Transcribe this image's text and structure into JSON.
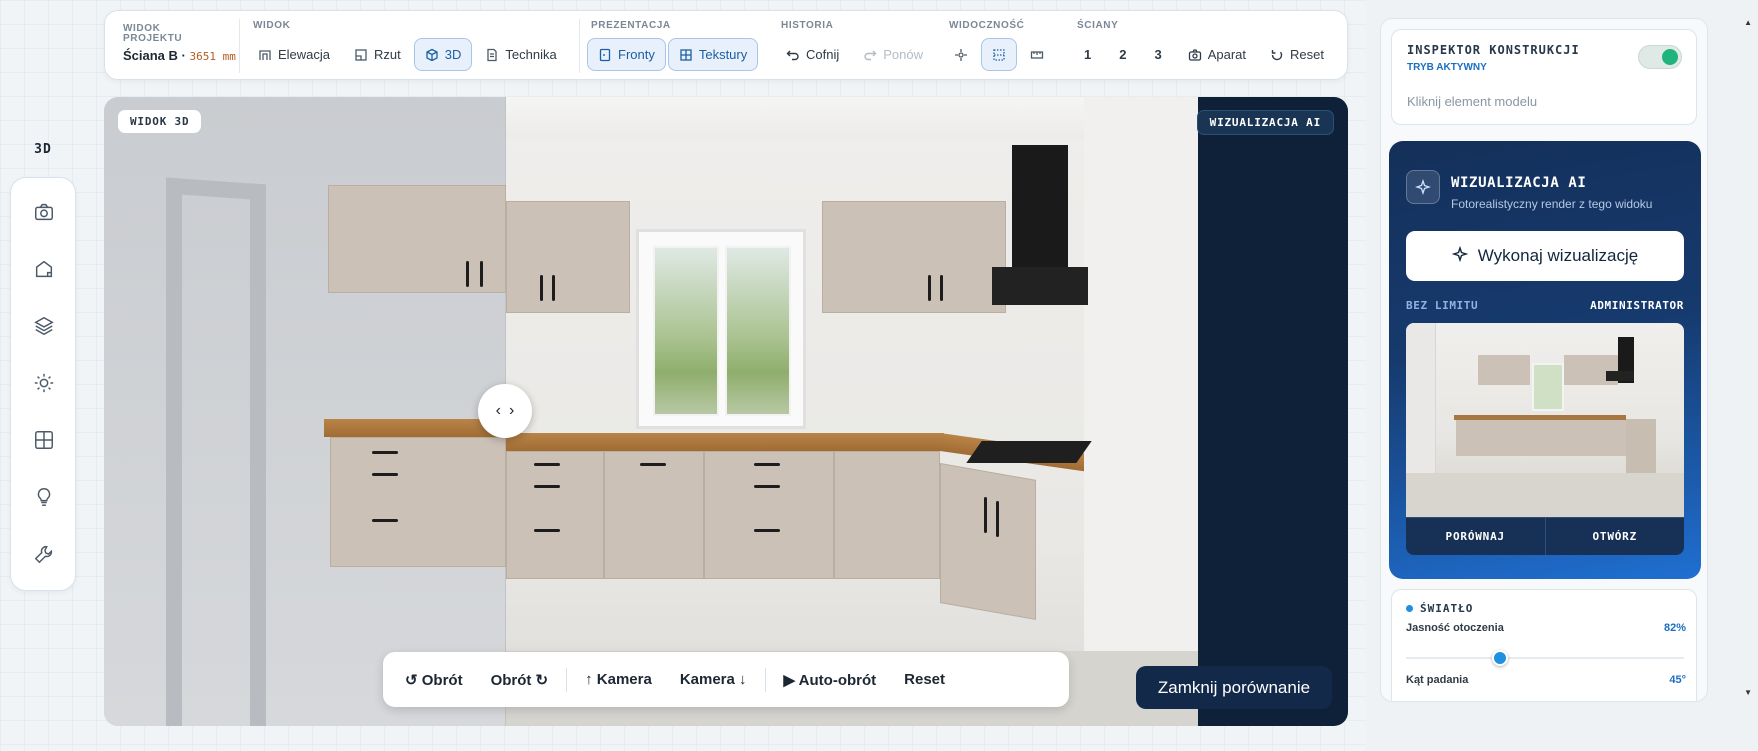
{
  "header": {
    "project_label": "WIDOK PROJEKTU",
    "wall_name": "Ściana B · ",
    "wall_dim": "3651 mm"
  },
  "toolbar": {
    "view": {
      "label": "WIDOK",
      "items": [
        "Elewacja",
        "Rzut",
        "3D",
        "Technika"
      ],
      "active": "3D"
    },
    "presentation": {
      "label": "PREZENTACJA",
      "items": [
        "Fronty",
        "Tekstury"
      ]
    },
    "history": {
      "label": "HISTORIA",
      "undo": "Cofnij",
      "redo": "Ponów"
    },
    "visibility": {
      "label": "WIDOCZNOŚĆ"
    },
    "walls": {
      "label": "ŚCIANY",
      "items": [
        "1",
        "2",
        "3"
      ],
      "camera": "Aparat",
      "reset": "Reset"
    }
  },
  "sidebar": {
    "title": "3D",
    "icons": [
      "camera-icon",
      "house-icon",
      "layers-icon",
      "sun-icon",
      "grid-icon",
      "bulb-icon",
      "wrench-icon"
    ]
  },
  "viewport": {
    "left_label": "WIDOK 3D",
    "right_label": "WIZUALIZACJA AI",
    "camera_controls": [
      "↺ Obrót",
      "Obrót ↻",
      "↑ Kamera",
      "Kamera ↓",
      "▶ Auto-obrót",
      "Reset"
    ],
    "close_compare": "Zamknij porównanie"
  },
  "inspector": {
    "title": "INSPEKTOR KONSTRUKCJI",
    "mode": "TRYB AKTYWNY",
    "hint": "Kliknij element modelu",
    "toggle_on": true
  },
  "ai_panel": {
    "title": "WIZUALIZACJA AI",
    "subtitle": "Fotorealistyczny render z tego widoku",
    "run_button": "Wykonaj wizualizację",
    "limit": "BEZ LIMITU",
    "role": "ADMINISTRATOR",
    "compare": "PORÓWNAJ",
    "open": "OTWÓRZ"
  },
  "light": {
    "title": "ŚWIATŁO",
    "ambient_label": "Jasność otoczenia",
    "ambient_value": "82%",
    "ambient_level": 0.33,
    "angle_label": "Kąt padania",
    "angle_value": "45°"
  },
  "colors": {
    "accent": "#1f8fe0",
    "ai_dark": "#14305a",
    "toggle_on": "#1fb47b"
  }
}
